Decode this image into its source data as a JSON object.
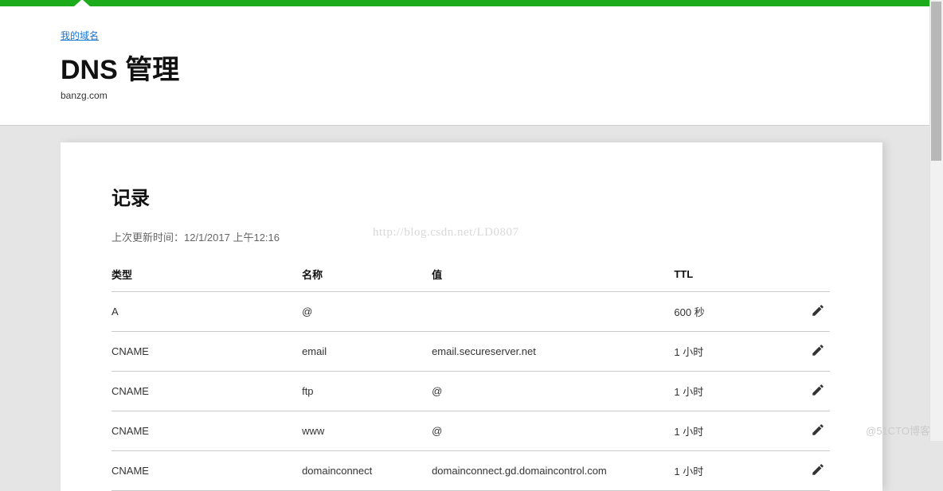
{
  "header": {
    "breadcrumb": "我的域名",
    "title": "DNS 管理",
    "domain": "banzg.com"
  },
  "records": {
    "heading": "记录",
    "last_updated_label": "上次更新时间：",
    "last_updated_value": "12/1/2017 上午12:16",
    "columns": {
      "type": "类型",
      "name": "名称",
      "value": "值",
      "ttl": "TTL"
    },
    "rows": [
      {
        "type": "A",
        "name": "@",
        "value": "",
        "ttl": "600 秒"
      },
      {
        "type": "CNAME",
        "name": "email",
        "value": "email.secureserver.net",
        "ttl": "1 小时"
      },
      {
        "type": "CNAME",
        "name": "ftp",
        "value": "@",
        "ttl": "1 小时"
      },
      {
        "type": "CNAME",
        "name": "www",
        "value": "@",
        "ttl": "1 小时"
      },
      {
        "type": "CNAME",
        "name": "domainconnect",
        "value": "domainconnect.gd.domaincontrol.com",
        "ttl": "1 小时"
      }
    ]
  },
  "watermark": "http://blog.csdn.net/LD0807",
  "footer_watermark": "@51CTO博客"
}
